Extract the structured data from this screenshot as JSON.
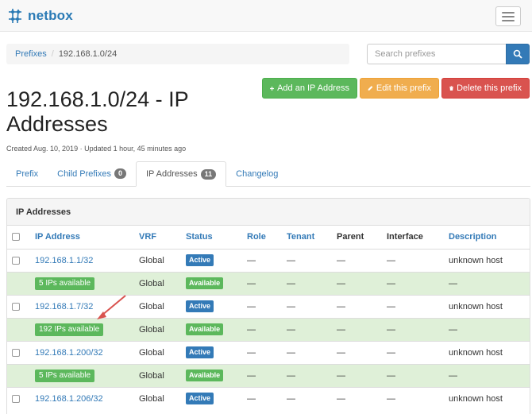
{
  "app": {
    "brand": "netbox"
  },
  "breadcrumb": {
    "parent": "Prefixes",
    "current": "192.168.1.0/24"
  },
  "search": {
    "placeholder": "Search prefixes"
  },
  "actions": {
    "add": "Add an IP Address",
    "edit": "Edit this prefix",
    "delete": "Delete this prefix"
  },
  "title": "192.168.1.0/24 - IP Addresses",
  "meta": "Created Aug. 10, 2019 · Updated 1 hour, 45 minutes ago",
  "tabs": [
    {
      "label": "Prefix",
      "badge": ""
    },
    {
      "label": "Child Prefixes",
      "badge": "0"
    },
    {
      "label": "IP Addresses",
      "badge": "11"
    },
    {
      "label": "Changelog",
      "badge": ""
    }
  ],
  "panel": {
    "heading": "IP Addresses",
    "columns": [
      "IP Address",
      "VRF",
      "Status",
      "Role",
      "Tenant",
      "Parent",
      "Interface",
      "Description"
    ],
    "rows": [
      {
        "ip": "192.168.1.1/32",
        "vrf": "Global",
        "status": "Active",
        "role": "—",
        "tenant": "—",
        "parent": "—",
        "interface": "—",
        "description": "unknown host"
      },
      {
        "avail": "5 IPs available",
        "vrf": "Global",
        "status": "Available",
        "role": "—",
        "tenant": "—",
        "parent": "—",
        "interface": "—",
        "description": "—"
      },
      {
        "ip": "192.168.1.7/32",
        "vrf": "Global",
        "status": "Active",
        "role": "—",
        "tenant": "—",
        "parent": "—",
        "interface": "—",
        "description": "unknown host"
      },
      {
        "avail": "192 IPs available",
        "vrf": "Global",
        "status": "Available",
        "role": "—",
        "tenant": "—",
        "parent": "—",
        "interface": "—",
        "description": "—"
      },
      {
        "ip": "192.168.1.200/32",
        "vrf": "Global",
        "status": "Active",
        "role": "—",
        "tenant": "—",
        "parent": "—",
        "interface": "—",
        "description": "unknown host"
      },
      {
        "avail": "5 IPs available",
        "vrf": "Global",
        "status": "Available",
        "role": "—",
        "tenant": "—",
        "parent": "—",
        "interface": "—",
        "description": "—"
      },
      {
        "ip": "192.168.1.206/32",
        "vrf": "Global",
        "status": "Active",
        "role": "—",
        "tenant": "—",
        "parent": "—",
        "interface": "—",
        "description": "unknown host"
      }
    ]
  },
  "colors": {
    "primary": "#337ab7",
    "success": "#5cb85c",
    "warning": "#f0ad4e",
    "danger": "#d9534f",
    "available_row": "#dff0d8",
    "annotation_arrow": "#d9534f"
  },
  "icons": {
    "brand": "netbox-logo-icon",
    "menu": "hamburger-icon",
    "search": "search-icon",
    "add": "plus-icon",
    "edit": "pencil-icon",
    "delete": "trash-icon"
  }
}
